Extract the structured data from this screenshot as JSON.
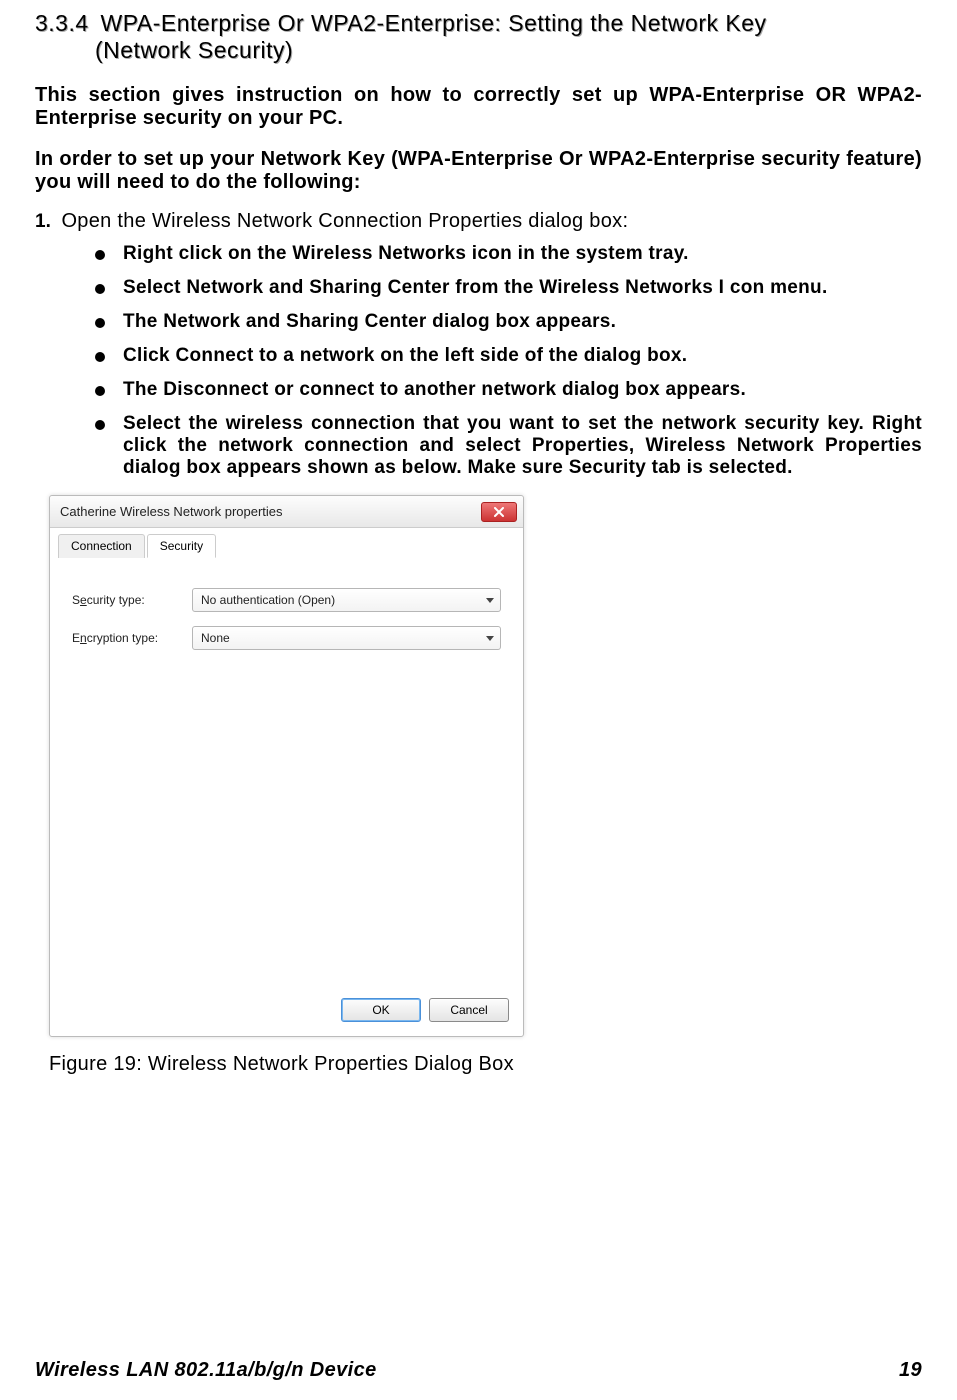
{
  "heading": {
    "number": "3.3.4",
    "title_line1": "WPA-Enterprise Or WPA2-Enterprise:  Setting the Network Key",
    "title_line2": "(Network Security)"
  },
  "intro": "This section gives instruction on how to correctly set up WPA-Enterprise OR WPA2-Enterprise security on your PC.",
  "lead": "In order to set up your Network Key (WPA-Enterprise Or WPA2-Enterprise security feature) you will need to do the following:",
  "step1_label": "1.",
  "step1_text": "Open the Wireless Network Connection Properties dialog box:",
  "bullets": [
    "Right click on the Wireless Networks icon in the system tray.",
    "Select Network and Sharing Center from the Wireless Networks I con menu.",
    "The Network and Sharing Center dialog box appears.",
    "Click Connect to a network on the left side of the dialog box.",
    "The Disconnect or connect to another network dialog box appears.",
    "Select the wireless connection that you want to set the network security key. Right click the network connection and select Properties, Wireless Network Properties dialog box appears shown as below.  Make sure Security tab is selected."
  ],
  "dialog": {
    "title": "Catherine Wireless Network properties",
    "tabs": {
      "connection": "Connection",
      "security": "Security"
    },
    "security_type_label": "Security type:",
    "security_type_value": "No authentication (Open)",
    "encryption_type_label": "Encryption type:",
    "encryption_type_value": "None",
    "ok": "OK",
    "cancel": "Cancel"
  },
  "figure_caption": "Figure 19: Wireless Network Properties Dialog Box",
  "footer": {
    "left": "Wireless LAN 802.11a/b/g/n Device",
    "page": "19"
  }
}
